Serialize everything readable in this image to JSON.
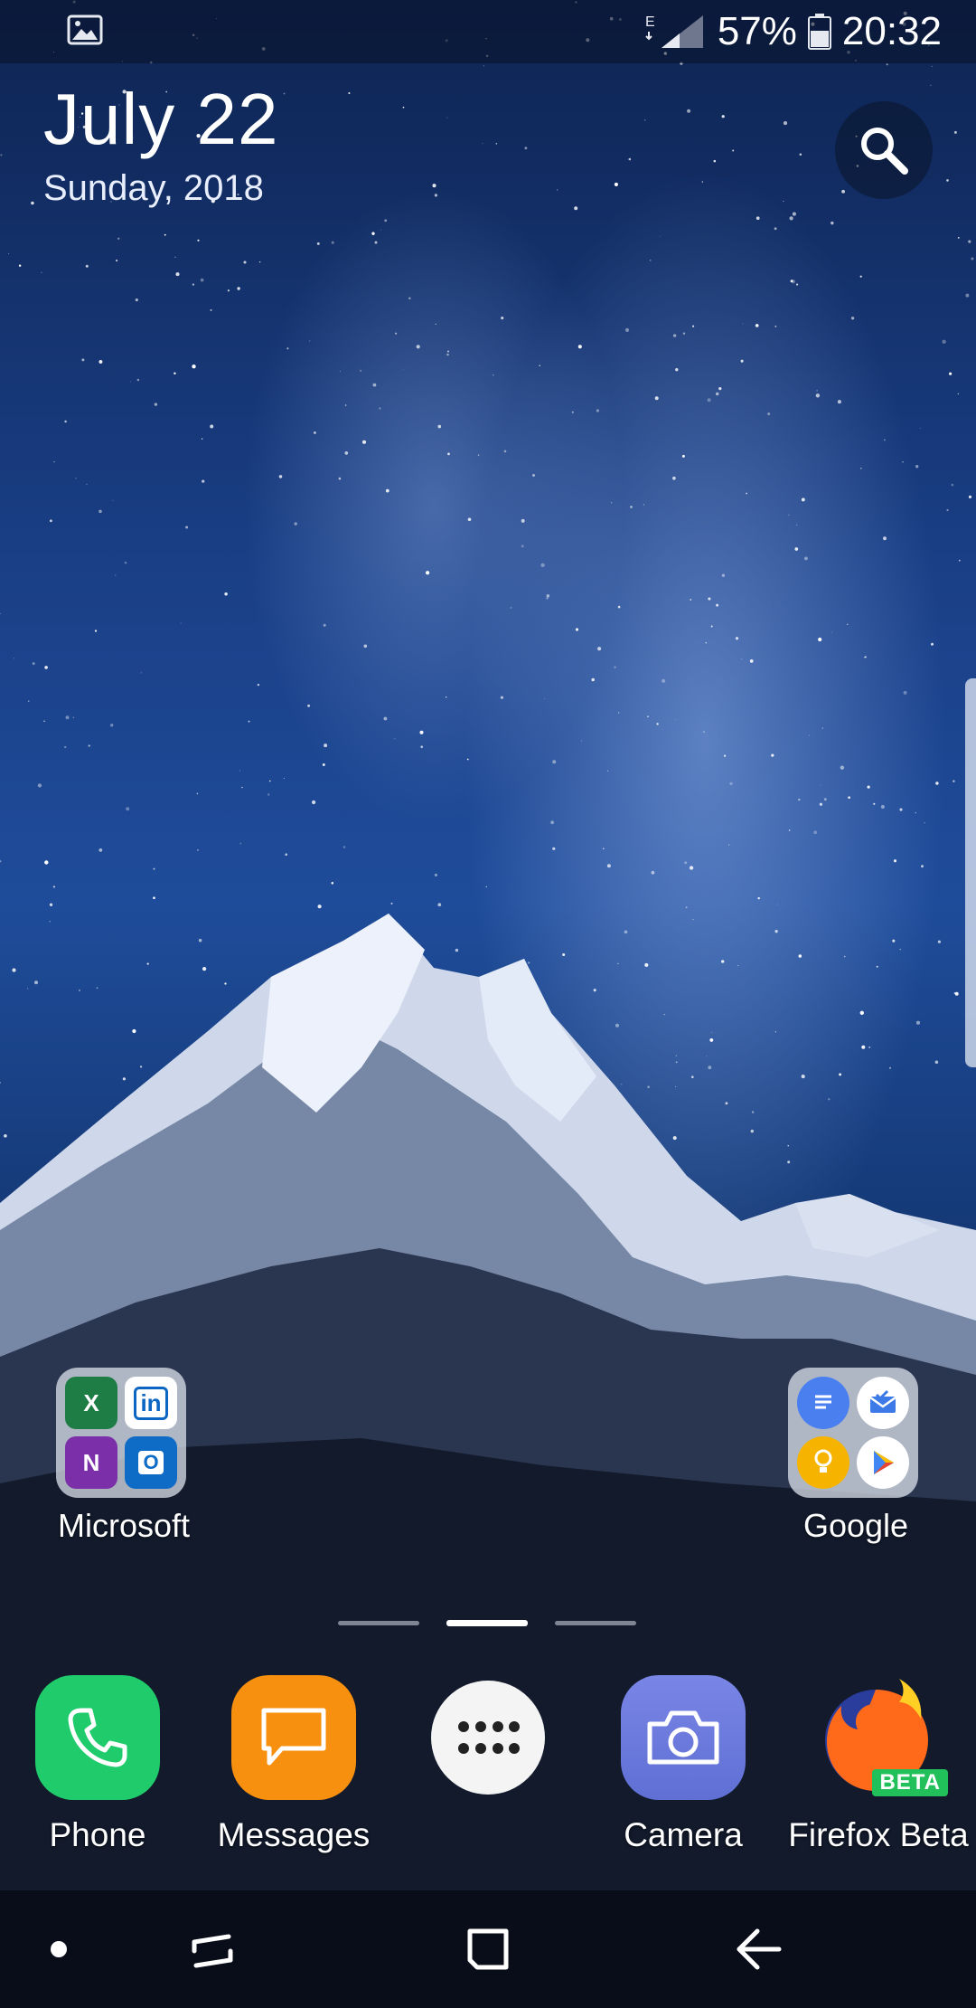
{
  "status_bar": {
    "left_icon": "gallery-icon",
    "network_type": "E",
    "battery_percent": "57%",
    "time": "20:32"
  },
  "date_widget": {
    "date": "July 22",
    "day_year": "Sunday, 2018"
  },
  "folders": {
    "microsoft": {
      "label": "Microsoft",
      "apps": [
        "excel-icon",
        "linkedin-icon",
        "onenote-icon",
        "outlook-icon"
      ],
      "mini_text": [
        "X",
        "in",
        "N",
        "O"
      ]
    },
    "google": {
      "label": "Google",
      "apps": [
        "docs-icon",
        "inbox-icon",
        "keep-icon",
        "play-store-icon"
      ]
    }
  },
  "pager": {
    "pages": 3,
    "active": 2
  },
  "dock": [
    {
      "label": "Phone",
      "icon": "phone-icon",
      "color": "#1fcb6a"
    },
    {
      "label": "Messages",
      "icon": "messages-icon",
      "color": "#f78f0f"
    },
    {
      "label": "",
      "icon": "apps-icon",
      "color": "#f4f4f4"
    },
    {
      "label": "Camera",
      "icon": "camera-icon",
      "color": "#6f7fe0"
    },
    {
      "label": "Firefox Beta",
      "icon": "firefox-beta-icon",
      "badge": "BETA",
      "color": "#ff6a1a"
    }
  ],
  "nav_bar": [
    "dot-icon",
    "recents-icon",
    "home-icon",
    "back-icon"
  ]
}
